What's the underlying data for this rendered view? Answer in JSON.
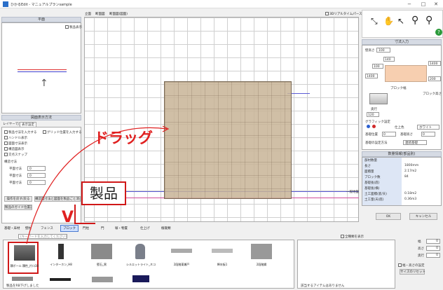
{
  "window": {
    "title": "ひかるEdit - マニュアルプランsample"
  },
  "controls": {
    "minimize": "−",
    "maximize": "□",
    "close": "✕"
  },
  "left_panel": {
    "plan_header": "平面",
    "product_display_chk": "製品表示",
    "display_header": "図面表示方法",
    "tabs": [
      "レイヤーで出",
      "表示設定"
    ],
    "options": [
      "製品寸法を入力する",
      "グリッド位置を入力する",
      "ハンドル表示",
      "図面寸法表示",
      "構造図表示",
      "交点スナップ"
    ],
    "spacing_header": "構造寸法",
    "rows": [
      {
        "label": "平面寸法",
        "value": "0"
      },
      {
        "label": "平面寸法",
        "value": "0"
      },
      {
        "label": "平面寸法",
        "value": "0"
      }
    ],
    "btn_left": "操作を戻す/戻る",
    "btn_right": "構造図寸法と図面を製品ごと消去",
    "btn_bottom": "製品のガイド位置設定"
  },
  "canvas_tabs": [
    "立面",
    "断面図",
    "断面図(図面)"
  ],
  "canvas_right_label": "3Dリアルタイムパース",
  "canvas_line_label": "一般地盤",
  "toolbar_icons": [
    "select-cursor-icon",
    "hand-icon",
    "pointer-icon",
    "pin-icon",
    "pin-icon"
  ],
  "right_panel": {
    "header": "寸法入力",
    "height_label": "壁高さ",
    "height_value": "100",
    "fields": [
      "140",
      "100",
      "1400",
      "1400",
      "200"
    ],
    "width_label": "ブロック幅",
    "depth_label": "ブロック高さ",
    "depth_label2": "奥行",
    "depth_value": "120",
    "group_label": "グラフィック設定",
    "color_label": "仕上色",
    "color_value": "ホワイト",
    "fit_label": "基礎位置",
    "fit_value": "0",
    "fit_label2": "基礎高さ",
    "fit_value2": "0",
    "mode_label": "基礎の設定方法",
    "mode_value": "連続基礎",
    "info_header": "数量情報(部品別)",
    "info_rows": [
      {
        "k": "部材数量",
        "v": ""
      },
      {
        "k": "長さ",
        "v": "1800mm"
      },
      {
        "k": "面積量",
        "v": "2.17m2"
      },
      {
        "k": "ブロック数",
        "v": "84"
      },
      {
        "k": "基礎長(底)",
        "v": ""
      },
      {
        "k": "基礎長(横)",
        "v": ""
      },
      {
        "k": "土工面積(底/天)",
        "v": "0.18m2"
      },
      {
        "k": "土工量(天/底)",
        "v": "0.36m3"
      }
    ],
    "ok": "OK",
    "cancel": "キャンセル"
  },
  "category_tabs": [
    "基礎・床材",
    "壁材",
    "フェンス",
    "ブロック",
    "門柱",
    "門",
    "塀・物置",
    "仕上げ",
    "植栽類"
  ],
  "search_placeholder": "(キーワードを入力してください)",
  "search_chk": "全種類を表示",
  "products": [
    {
      "name": "積ポール 積性_片口3B",
      "icon": "block-wall-icon"
    },
    {
      "name": "インターホン_H8",
      "icon": "post-icon"
    },
    {
      "name": "壁石_黒",
      "icon": "stone-icon"
    },
    {
      "name": "シルエットライト_ネコ",
      "icon": "cat-light-icon"
    },
    {
      "name": "2段階東瀬戸",
      "icon": "bar-icon"
    },
    {
      "name": "降灰板1",
      "icon": "bar-icon"
    },
    {
      "name": "2段階鋼",
      "icon": "panel-icon"
    }
  ],
  "products_row2_caption": "製品をRB下げしました",
  "preview_caption": "該当するアイテムはありません",
  "right_small": {
    "chk_label": "幅・高さの設定",
    "btn": "サイズのリセット",
    "labels": [
      "幅",
      "高さ",
      "奥行"
    ],
    "values": [
      "0",
      "0",
      "0"
    ]
  },
  "annotations": {
    "drag": "ドラッグ",
    "product": "製品",
    "check": "V"
  },
  "colors": {
    "annotation_red": "#e02020",
    "product_fill": "#c8b496"
  }
}
